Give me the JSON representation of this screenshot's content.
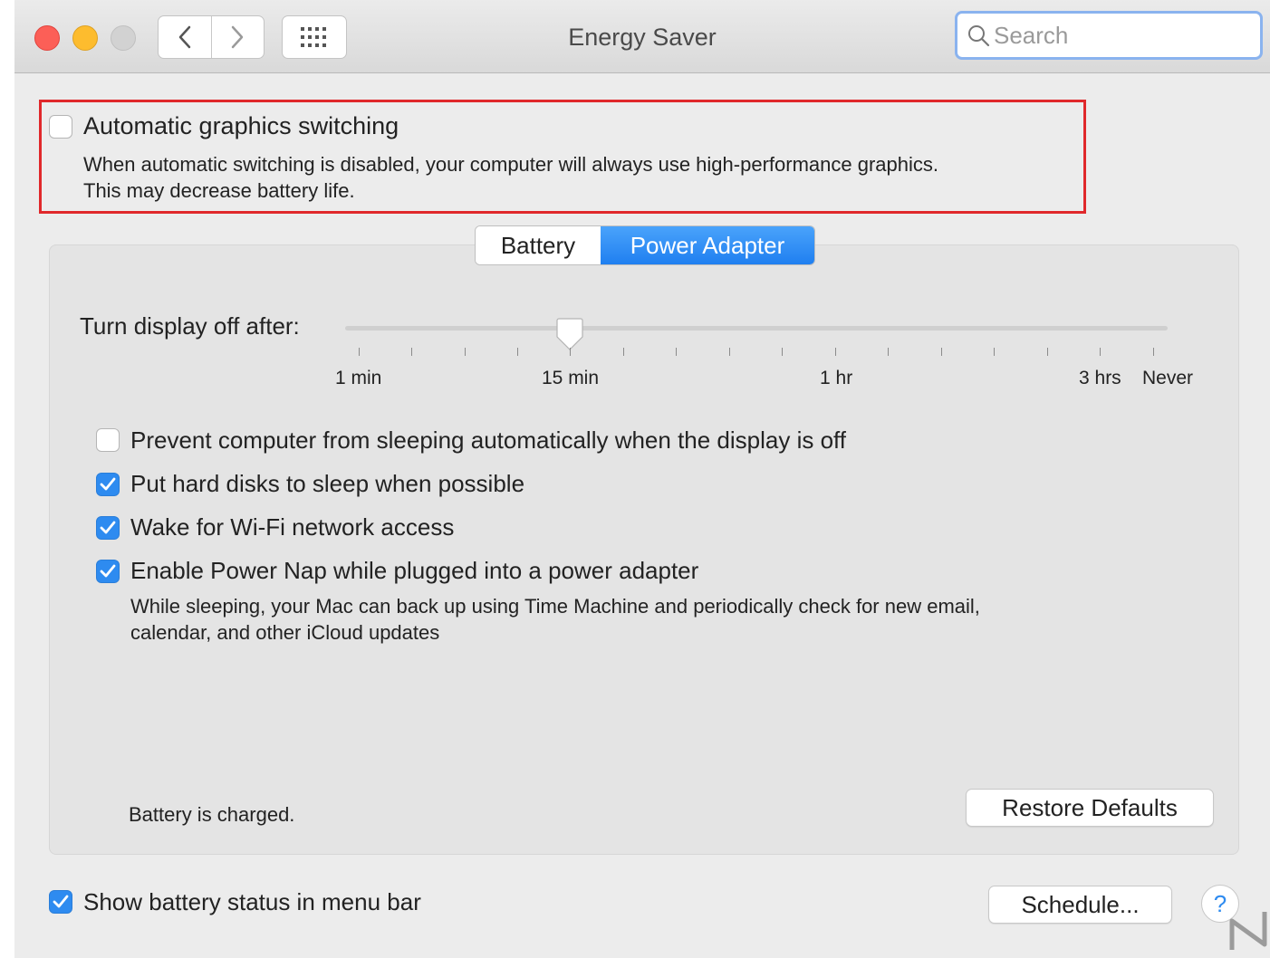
{
  "window": {
    "title": "Energy Saver"
  },
  "search": {
    "placeholder": "Search"
  },
  "graphics": {
    "label": "Automatic graphics switching",
    "checked": false,
    "description_line1": "When automatic switching is disabled, your computer will always use high-performance graphics.",
    "description_line2": "This may decrease battery life."
  },
  "tabs": [
    {
      "label": "Battery",
      "selected": false
    },
    {
      "label": "Power Adapter",
      "selected": true
    }
  ],
  "display_sleep": {
    "label": "Turn display off after:",
    "value": "15 min",
    "tick_labels": [
      "1 min",
      "15 min",
      "1 hr",
      "3 hrs",
      "Never"
    ]
  },
  "options": [
    {
      "label": "Prevent computer from sleeping automatically when the display is off",
      "checked": false
    },
    {
      "label": "Put hard disks to sleep when possible",
      "checked": true
    },
    {
      "label": "Wake for Wi-Fi network access",
      "checked": true
    },
    {
      "label": "Enable Power Nap while plugged into a power adapter",
      "checked": true
    }
  ],
  "power_nap_description": {
    "line1": "While sleeping, your Mac can back up using Time Machine and periodically check for new email,",
    "line2": "calendar, and other iCloud updates"
  },
  "status": {
    "battery_text": "Battery is charged."
  },
  "buttons": {
    "restore_defaults": "Restore Defaults",
    "schedule": "Schedule...",
    "help": "?"
  },
  "menu_bar_option": {
    "label": "Show battery status in menu bar",
    "checked": true
  },
  "colors": {
    "accent": "#2e8bf0",
    "highlight_border": "#e0282b",
    "close": "#fc5f57",
    "minimize": "#fdbc2e",
    "zoom_disabled": "#d2d2d2"
  }
}
